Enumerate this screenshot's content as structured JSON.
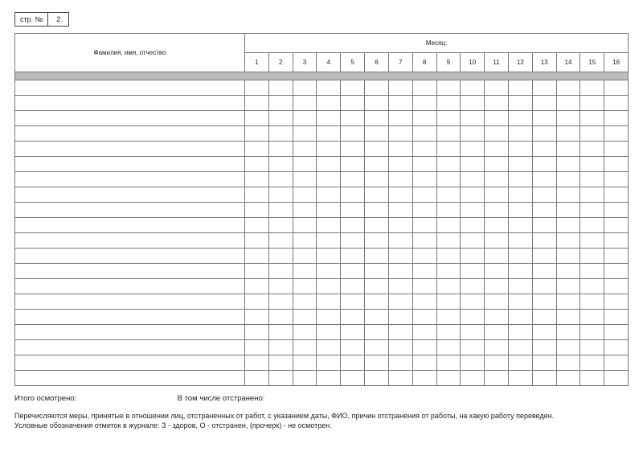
{
  "page_label": "стр. №",
  "page_number": "2",
  "header_name": "Фамилия, имя, отчество",
  "header_month": "Месяц:",
  "day_numbers": [
    "1",
    "2",
    "3",
    "4",
    "5",
    "6",
    "7",
    "8",
    "9",
    "10",
    "11",
    "12",
    "13",
    "14",
    "15",
    "16"
  ],
  "body_row_count": 20,
  "totals": {
    "inspected": "Итого осмотрено:",
    "suspended": "В том числе отстранено:"
  },
  "note_line1": "Перечисляются меры, принятые в отношении лиц, отстраненных от работ, с указанием даты, ФИО, причин отстранения от работы, на какую работу переведен.",
  "note_line2": "Условные обозначения отметок в журнале: З - здоров, О - отстранен, (прочерк) - не осмотрен."
}
